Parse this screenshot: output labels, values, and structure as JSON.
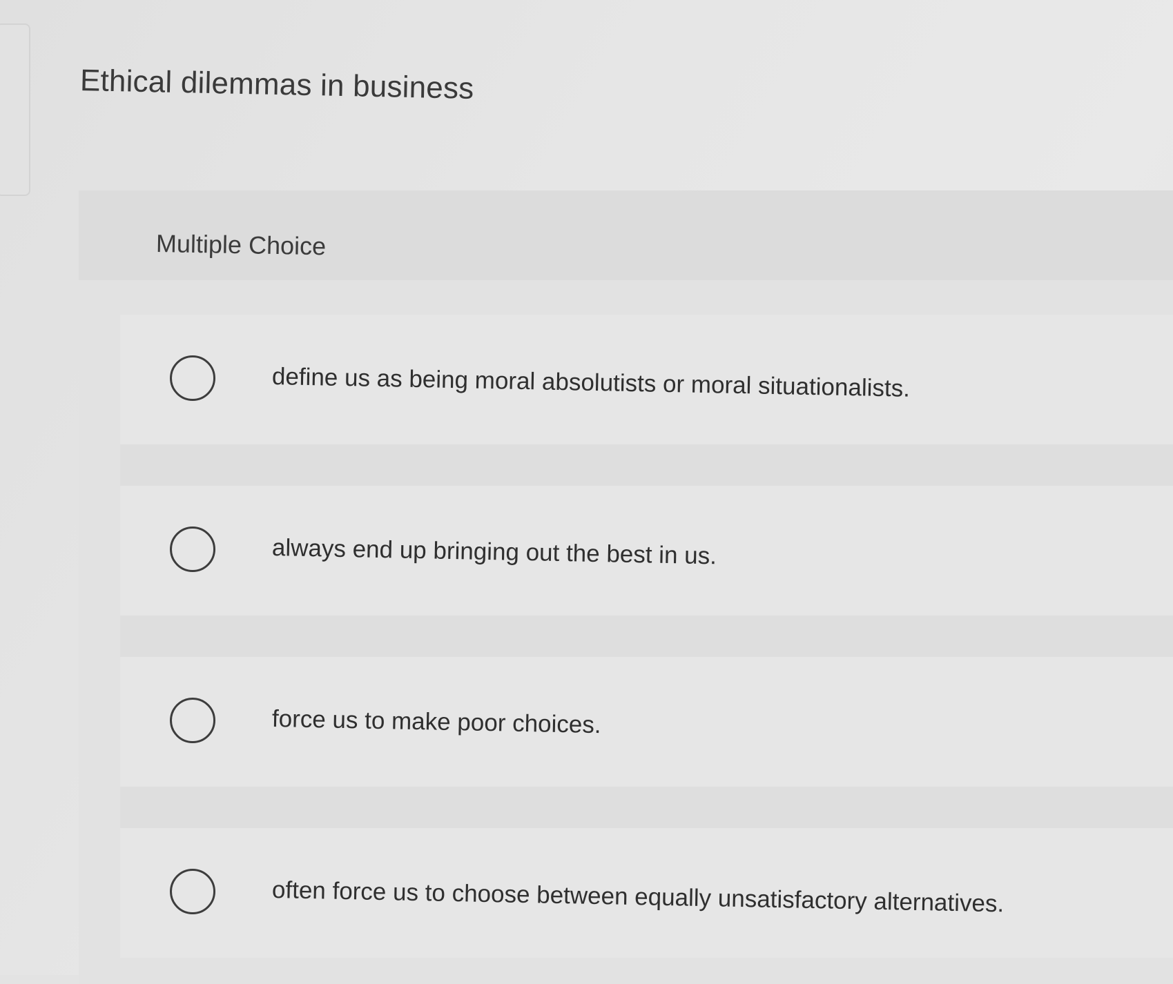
{
  "question": {
    "title": "Ethical dilemmas in business"
  },
  "card": {
    "type_label": "Multiple Choice",
    "options": [
      {
        "label": "define us as being moral absolutists or moral situationalists.",
        "selected": false
      },
      {
        "label": "always end up bringing out the best in us.",
        "selected": false
      },
      {
        "label": "force us to make poor choices.",
        "selected": false
      },
      {
        "label": "often force us to choose between equally unsatisfactory alternatives.",
        "selected": false
      }
    ]
  }
}
